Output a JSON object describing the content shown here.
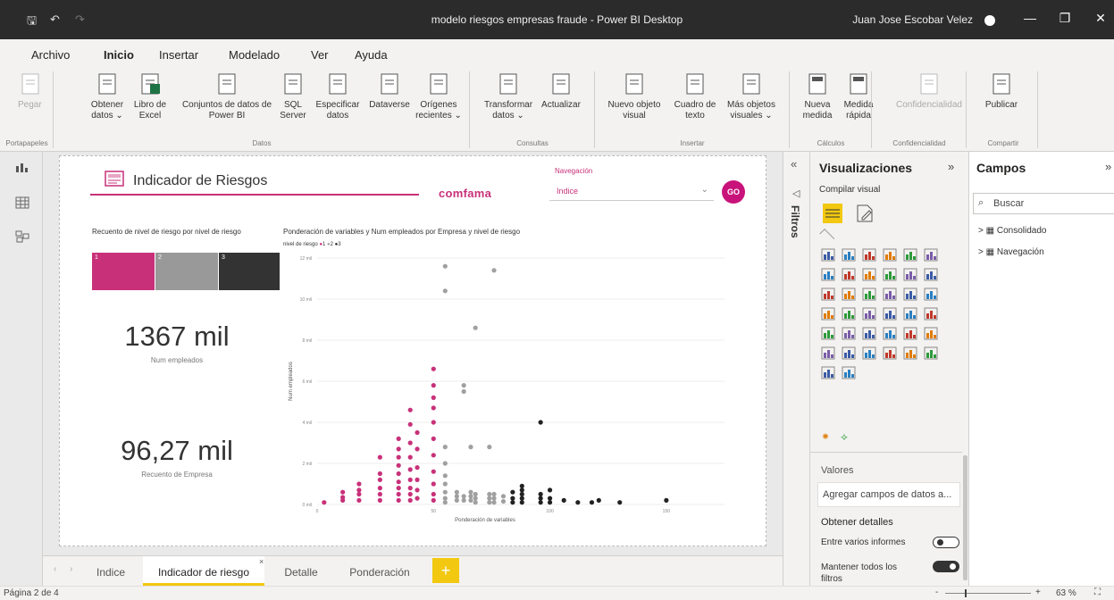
{
  "window": {
    "title": "modelo riesgos empresas fraude - Power BI Desktop",
    "user": "Juan Jose Escobar Velez"
  },
  "menu": [
    "Archivo",
    "Inicio",
    "Insertar",
    "Modelado",
    "Ver",
    "Ayuda"
  ],
  "ribbon": {
    "buttons": [
      {
        "l1": "Pegar",
        "l2": "",
        "disabled": true
      },
      {
        "l1": "Obtener",
        "l2": "datos ⌄"
      },
      {
        "l1": "Libro de",
        "l2": "Excel"
      },
      {
        "l1": "Conjuntos de datos de",
        "l2": "Power BI"
      },
      {
        "l1": "SQL",
        "l2": "Server"
      },
      {
        "l1": "Especificar",
        "l2": "datos"
      },
      {
        "l1": "Dataverse",
        "l2": ""
      },
      {
        "l1": "Orígenes",
        "l2": "recientes ⌄"
      },
      {
        "l1": "Transformar",
        "l2": "datos ⌄"
      },
      {
        "l1": "Actualizar",
        "l2": ""
      },
      {
        "l1": "Nuevo objeto",
        "l2": "visual"
      },
      {
        "l1": "Cuadro de",
        "l2": "texto"
      },
      {
        "l1": "Más objetos",
        "l2": "visuales ⌄"
      },
      {
        "l1": "Nueva",
        "l2": "medida"
      },
      {
        "l1": "Medida",
        "l2": "rápida"
      },
      {
        "l1": "Confidencialidad",
        "l2": "",
        "disabled": true
      },
      {
        "l1": "Publicar",
        "l2": ""
      }
    ],
    "groups": [
      "Portapapeles",
      "Datos",
      "Consultas",
      "Insertar",
      "Cálculos",
      "Confidencialidad",
      "Compartir"
    ]
  },
  "report": {
    "title": "Indicador de Riesgos",
    "brand": "comfama",
    "nav_label": "Navegación",
    "nav_value": "Indice",
    "go_label": "GO",
    "bar_title": "Recuento de nivel de riesgo por nivel de riesgo",
    "bar_segments": [
      {
        "label": "1",
        "color": "#c8317a"
      },
      {
        "label": "2",
        "color": "#999999"
      },
      {
        "label": "3",
        "color": "#333333"
      }
    ],
    "kpi1_value": "1367 mil",
    "kpi1_label": "Num empleados",
    "kpi2_value": "96,27 mil",
    "kpi2_label": "Recuento de Empresa",
    "scatter_title": "Ponderación de variables y Num empleados por Empresa y nivel de riesgo",
    "legend_title": "nivel de riesgo",
    "legend": [
      "1",
      "2",
      "3"
    ],
    "colors": {
      "1": "#c8317a",
      "2": "#a0a0a0",
      "3": "#222222"
    }
  },
  "chart_data": {
    "type": "scatter",
    "title": "Ponderación de variables y Num empleados por Empresa y nivel de riesgo",
    "xlabel": "Ponderación de variables",
    "ylabel": "Num empleados",
    "xlim": [
      0,
      175
    ],
    "ylim": [
      0,
      12000
    ],
    "xticks": [
      {
        "v": 0,
        "t": "0"
      },
      {
        "v": 50,
        "t": "50"
      },
      {
        "v": 100,
        "t": "100"
      },
      {
        "v": 150,
        "t": "150"
      }
    ],
    "yticks": [
      {
        "v": 0,
        "t": "0 mil"
      },
      {
        "v": 2000,
        "t": "2 mil"
      },
      {
        "v": 4000,
        "t": "4 mil"
      },
      {
        "v": 6000,
        "t": "6 mil"
      },
      {
        "v": 8000,
        "t": "8 mil"
      },
      {
        "v": 10000,
        "t": "10 mil"
      },
      {
        "v": 12000,
        "t": "12 mil"
      }
    ],
    "series": [
      {
        "name": "1",
        "points": [
          [
            3,
            100
          ],
          [
            11,
            200
          ],
          [
            11,
            350
          ],
          [
            11,
            600
          ],
          [
            18,
            200
          ],
          [
            18,
            500
          ],
          [
            18,
            700
          ],
          [
            18,
            1000
          ],
          [
            27,
            200
          ],
          [
            27,
            500
          ],
          [
            27,
            800
          ],
          [
            27,
            1200
          ],
          [
            27,
            1500
          ],
          [
            27,
            2300
          ],
          [
            35,
            200
          ],
          [
            35,
            500
          ],
          [
            35,
            800
          ],
          [
            35,
            1100
          ],
          [
            35,
            1500
          ],
          [
            35,
            1900
          ],
          [
            35,
            2300
          ],
          [
            35,
            2700
          ],
          [
            35,
            3200
          ],
          [
            40,
            200
          ],
          [
            40,
            500
          ],
          [
            40,
            800
          ],
          [
            40,
            1200
          ],
          [
            40,
            1700
          ],
          [
            40,
            2300
          ],
          [
            40,
            3000
          ],
          [
            40,
            3900
          ],
          [
            40,
            4600
          ],
          [
            43,
            300
          ],
          [
            43,
            700
          ],
          [
            43,
            1200
          ],
          [
            43,
            1800
          ],
          [
            43,
            2700
          ],
          [
            43,
            3500
          ],
          [
            50,
            200
          ],
          [
            50,
            500
          ],
          [
            50,
            1000
          ],
          [
            50,
            1600
          ],
          [
            50,
            2400
          ],
          [
            50,
            3200
          ],
          [
            50,
            4000
          ],
          [
            50,
            4700
          ],
          [
            50,
            5200
          ],
          [
            50,
            5800
          ],
          [
            50,
            6600
          ]
        ]
      },
      {
        "name": "2",
        "points": [
          [
            55,
            100
          ],
          [
            55,
            300
          ],
          [
            55,
            600
          ],
          [
            55,
            1000
          ],
          [
            55,
            1400
          ],
          [
            55,
            2000
          ],
          [
            55,
            2800
          ],
          [
            55,
            11600
          ],
          [
            55,
            10400
          ],
          [
            60,
            200
          ],
          [
            60,
            400
          ],
          [
            60,
            600
          ],
          [
            63,
            200
          ],
          [
            63,
            400
          ],
          [
            63,
            5500
          ],
          [
            63,
            5800
          ],
          [
            66,
            200
          ],
          [
            66,
            400
          ],
          [
            66,
            600
          ],
          [
            66,
            2800
          ],
          [
            68,
            100
          ],
          [
            68,
            300
          ],
          [
            68,
            500
          ],
          [
            68,
            8600
          ],
          [
            74,
            100
          ],
          [
            74,
            300
          ],
          [
            74,
            500
          ],
          [
            74,
            2800
          ],
          [
            76,
            100
          ],
          [
            76,
            300
          ],
          [
            76,
            500
          ],
          [
            76,
            11400
          ],
          [
            80,
            150
          ],
          [
            80,
            400
          ]
        ]
      },
      {
        "name": "3",
        "points": [
          [
            84,
            100
          ],
          [
            84,
            300
          ],
          [
            84,
            600
          ],
          [
            88,
            100
          ],
          [
            88,
            300
          ],
          [
            88,
            500
          ],
          [
            88,
            700
          ],
          [
            88,
            900
          ],
          [
            96,
            100
          ],
          [
            96,
            300
          ],
          [
            96,
            500
          ],
          [
            96,
            4000
          ],
          [
            100,
            100
          ],
          [
            100,
            300
          ],
          [
            100,
            700
          ],
          [
            106,
            200
          ],
          [
            112,
            100
          ],
          [
            118,
            100
          ],
          [
            121,
            200
          ],
          [
            130,
            100
          ],
          [
            150,
            200
          ]
        ]
      }
    ]
  },
  "filters_label": "Filtros",
  "viz": {
    "title": "Visualizaciones",
    "sub": "Compilar visual",
    "values_label": "Valores",
    "values_placeholder": "Agregar campos de datos a...",
    "details_label": "Obtener detalles",
    "opt1": "Entre varios informes",
    "opt2": "Mantener todos los filtros"
  },
  "campos": {
    "title": "Campos",
    "search_placeholder": "Buscar",
    "tables": [
      "Consolidado",
      "Navegación"
    ]
  },
  "tabs": [
    "Indice",
    "Indicador de riesgo",
    "Detalle",
    "Ponderación"
  ],
  "status": {
    "page": "Página 2 de 4",
    "zoom": "63 %"
  }
}
